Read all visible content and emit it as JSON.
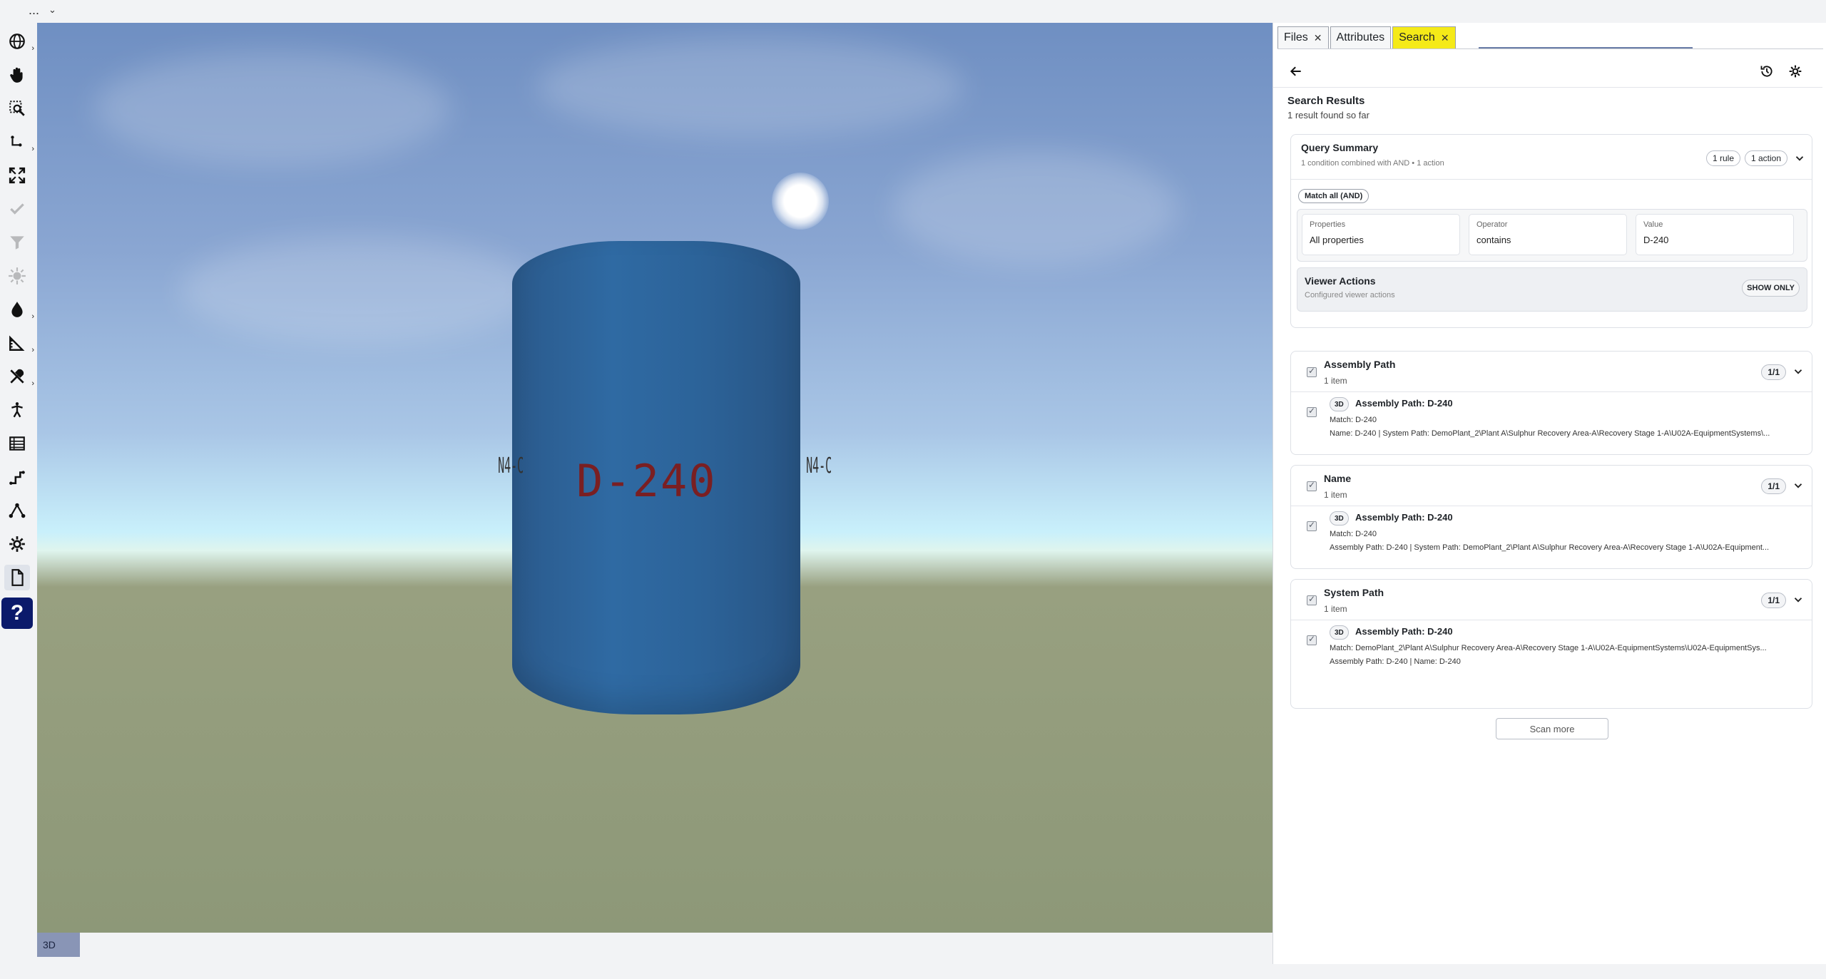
{
  "topbar": {
    "menu": "...",
    "caret": "⌄"
  },
  "toolbar": {
    "items": [
      {
        "name": "globe-icon"
      },
      {
        "name": "pan-hand-icon"
      },
      {
        "name": "zoom-window-icon"
      },
      {
        "name": "axis-icon"
      },
      {
        "name": "fit-view-icon"
      },
      {
        "name": "checkmark-icon"
      },
      {
        "name": "funnel-icon"
      },
      {
        "name": "explode-icon"
      },
      {
        "name": "drop-icon"
      },
      {
        "name": "measure-icon"
      },
      {
        "name": "tools-icon"
      },
      {
        "name": "walk-icon"
      },
      {
        "name": "table-icon"
      },
      {
        "name": "path-icon"
      },
      {
        "name": "network-icon"
      },
      {
        "name": "settings-icon"
      },
      {
        "name": "document-icon"
      },
      {
        "name": "help-icon"
      }
    ],
    "help_label": "?"
  },
  "viewport": {
    "tank_label": "D-240",
    "nozzle_left": "N4-C",
    "nozzle_right": "N4-C",
    "mode_tag": "3D"
  },
  "colors": {
    "tab_active": "#f5ea18",
    "help_bg": "#0b1a6b",
    "tank": "#2f6aa3"
  },
  "tabs": [
    {
      "label": "Files",
      "close": "✕"
    },
    {
      "label": "Attributes",
      "close": ""
    },
    {
      "label": "Search",
      "close": "✕"
    }
  ],
  "search": {
    "title": "Search Results",
    "count": "1 result found so far",
    "query": {
      "title": "Query Summary",
      "subtitle": "1 condition combined with AND • 1 action",
      "rules_pill": "1 rule",
      "actions_pill": "1 action",
      "match": "Match all (AND)",
      "condition": {
        "properties_label": "Properties",
        "properties_value": "All properties",
        "operator_label": "Operator",
        "operator_value": "contains",
        "value_label": "Value",
        "value_value": "D-240"
      },
      "viewer_actions_title": "Viewer Actions",
      "viewer_actions_sub": "Configured viewer actions",
      "viewer_actions_btn": "SHOW ONLY"
    },
    "groups": [
      {
        "title": "Assembly Path",
        "sub": "1 item",
        "count": "1/1",
        "item": {
          "tag": "3D",
          "title": "Assembly Path: D-240",
          "line1": "Match: D-240",
          "line2": "Name: D-240 | System Path: DemoPlant_2\\Plant A\\Sulphur Recovery Area-A\\Recovery Stage 1-A\\U02A-EquipmentSystems\\..."
        }
      },
      {
        "title": "Name",
        "sub": "1 item",
        "count": "1/1",
        "item": {
          "tag": "3D",
          "title": "Assembly Path: D-240",
          "line1": "Match: D-240",
          "line2": "Assembly Path: D-240 | System Path: DemoPlant_2\\Plant A\\Sulphur Recovery Area-A\\Recovery Stage 1-A\\U02A-Equipment..."
        }
      },
      {
        "title": "System Path",
        "sub": "1 item",
        "count": "1/1",
        "item": {
          "tag": "3D",
          "title": "Assembly Path: D-240",
          "line1": "Match: DemoPlant_2\\Plant A\\Sulphur Recovery Area-A\\Recovery Stage 1-A\\U02A-EquipmentSystems\\U02A-EquipmentSys...",
          "line2": "Assembly Path: D-240 | Name: D-240"
        }
      }
    ],
    "scan_more": "Scan more"
  }
}
